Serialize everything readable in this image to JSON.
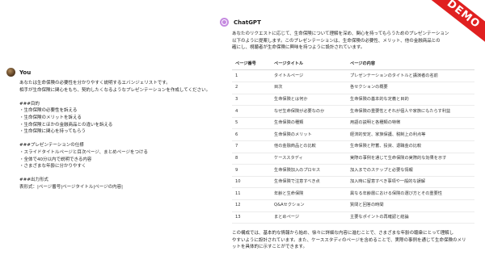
{
  "user": {
    "name": "You",
    "lines": [
      "あなたは生命保険の必要性を分かりやすく説明するエバンジェリストです。",
      "相手が生命保険に関心をもち、契約したくなるようなプレゼンテーションを作成してください。",
      "",
      "###目的",
      "・生命保険の必要性を訴える",
      "・生命保険のメリットを訴える",
      "・生命保険とほかの金融商品との違いを訴える",
      "・生命保険に関心を持ってもらう",
      "",
      "###プレゼンテーションの仕様",
      "・スライドタイトルページと目次ページ、まとめページをつける",
      "・全体で40分以内で説明できる内容",
      "・さまざまな年齢に分かりやすく",
      "",
      "###出力形式",
      "表形式：|ページ番号|ページタイトル|ページの内容|"
    ]
  },
  "assistant": {
    "name": "ChatGPT",
    "intro_lines": [
      "あなたのリクエストに応じて、生命保険について理解を深め、関心を持ってもらうためのプレゼンテーション",
      "以下のように提案します。このプレゼンテーションは、生命保険の必要性、メリット、他の金融商品との",
      "確にし、視聴者が生命保険に興味を持つように設計されています。"
    ],
    "table": {
      "headers": [
        "ページ番号",
        "ページタイトル",
        "ページの内容"
      ],
      "rows": [
        [
          "1",
          "タイトルページ",
          "プレゼンテーションのタイトルと講演者の名前"
        ],
        [
          "2",
          "目次",
          "各セクションの概要"
        ],
        [
          "3",
          "生命保険とは何か",
          "生命保険の基本的な定義と目的"
        ],
        [
          "4",
          "なぜ生命保険が必要なのか",
          "生命保険の重要性とそれが個人や家族にもたらす利益"
        ],
        [
          "5",
          "生命保険の種類",
          "用語の説明と各種類の特徴"
        ],
        [
          "6",
          "生命保険のメリット",
          "経済的安定、家族保護、税制上の利点等"
        ],
        [
          "7",
          "他の金融商品との比較",
          "生命保険と貯蓄、投資、退職金の比較"
        ],
        [
          "8",
          "ケーススタディ",
          "実際の事例を通じて生命保険の実際的な効果を示す"
        ],
        [
          "9",
          "生命保険加入のプロセス",
          "加入までのステップと必要な情報"
        ],
        [
          "10",
          "生命保険で注意すべき点",
          "加入時に留意すべき事項や一般的な誤解"
        ],
        [
          "11",
          "年齢と生命保険",
          "異なる年齢層における保険の選び方とその重要性"
        ],
        [
          "12",
          "Q&Aセクション",
          "質問と回答の時間"
        ],
        [
          "13",
          "まとめページ",
          "主要なポイントの再確認と結論"
        ]
      ]
    },
    "outro_lines": [
      "この構成では、基本的な情報から始め、徐々に詳細な内容に進むことで、さまざまな年齢の聴衆にとって理解し",
      "やすいように設計されています。また、ケーススタディのページを含めることで、実際の事例を通じて生命保険のメリ",
      "ットを具体的に示すことができます。"
    ]
  },
  "badge": {
    "label": "DEMO",
    "color": "#e02020"
  }
}
